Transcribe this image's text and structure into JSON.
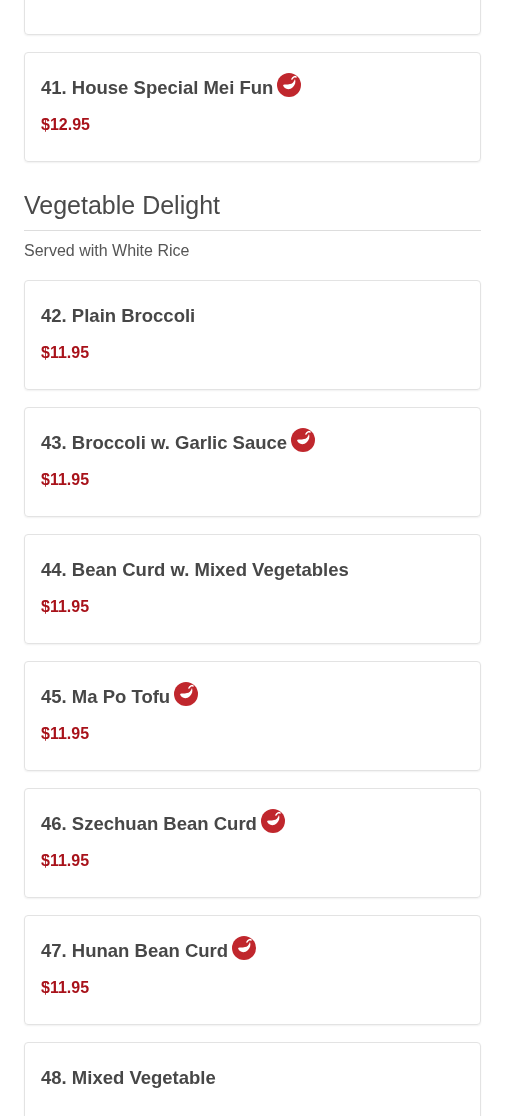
{
  "partial_card_above": true,
  "top_items": [
    {
      "name": "41. House Special Mei Fun",
      "price": "$12.95",
      "spicy": true
    }
  ],
  "section": {
    "title": "Vegetable Delight",
    "subtitle": "Served with White Rice",
    "items": [
      {
        "name": "42. Plain Broccoli",
        "price": "$11.95",
        "spicy": false
      },
      {
        "name": "43. Broccoli w. Garlic Sauce",
        "price": "$11.95",
        "spicy": true
      },
      {
        "name": "44. Bean Curd w. Mixed Vegetables",
        "price": "$11.95",
        "spicy": false
      },
      {
        "name": "45. Ma Po Tofu",
        "price": "$11.95",
        "spicy": true
      },
      {
        "name": "46. Szechuan Bean Curd",
        "price": "$11.95",
        "spicy": true
      },
      {
        "name": "47. Hunan Bean Curd",
        "price": "$11.95",
        "spicy": true
      },
      {
        "name": "48. Mixed Vegetable",
        "spicy": false
      }
    ]
  }
}
